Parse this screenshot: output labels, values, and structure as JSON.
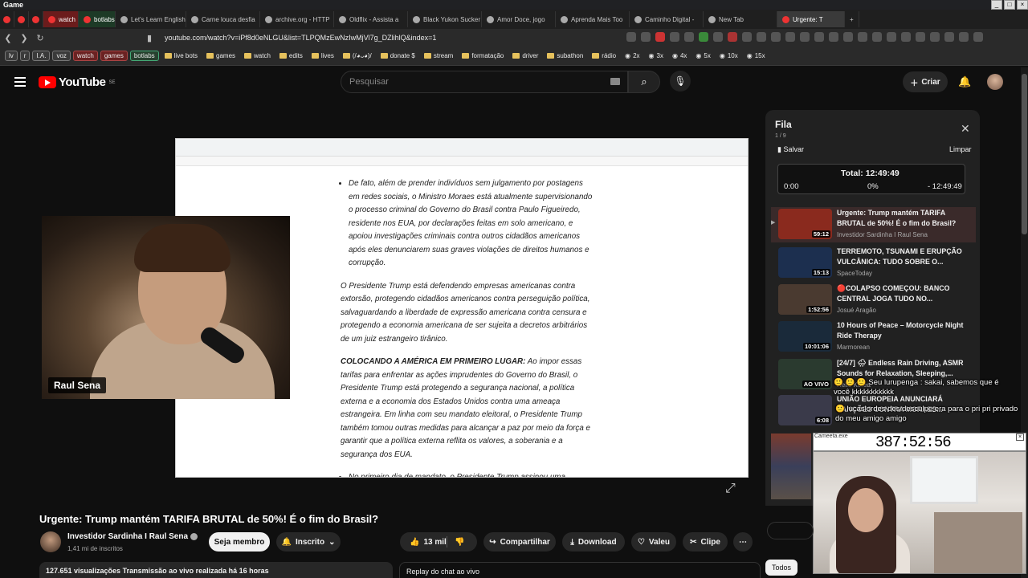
{
  "window": {
    "title": "Game"
  },
  "tabs": [
    {
      "label": "",
      "style": "pinned"
    },
    {
      "label": "",
      "style": "pinned"
    },
    {
      "label": "",
      "style": "pinned"
    },
    {
      "label": "watch",
      "style": "red"
    },
    {
      "label": "botlabs",
      "style": "green"
    },
    {
      "label": "Let's Learn English",
      "style": "plain"
    },
    {
      "label": "Carne louca desfia",
      "style": "plain"
    },
    {
      "label": "archive.org - HTTP",
      "style": "plain"
    },
    {
      "label": "Oldflix - Assista a",
      "style": "plain"
    },
    {
      "label": "Black Yukon Sucker",
      "style": "plain"
    },
    {
      "label": "Amor Doce, jogo",
      "style": "plain"
    },
    {
      "label": "Aprenda Mais Too",
      "style": "plain"
    },
    {
      "label": "Caminho Digital -",
      "style": "plain"
    },
    {
      "label": "New Tab",
      "style": "plain"
    },
    {
      "label": "Urgente: T",
      "style": "active"
    }
  ],
  "address": {
    "url": "youtube.com/watch?v=iPf8d0eNLGU&list=TLPQMzEwNzIwMjVl7g_DZlihlQ&index=1"
  },
  "bookmarks": [
    {
      "label": "lv",
      "kind": "tag"
    },
    {
      "label": "r",
      "kind": "tag"
    },
    {
      "label": "I.A.",
      "kind": "tag"
    },
    {
      "label": "voz",
      "kind": "tag"
    },
    {
      "label": "watch",
      "kind": "tag"
    },
    {
      "label": "games",
      "kind": "tag"
    },
    {
      "label": "botlabs",
      "kind": "tag"
    },
    {
      "label": "live bots",
      "kind": "folder"
    },
    {
      "label": "games",
      "kind": "folder"
    },
    {
      "label": "watch",
      "kind": "folder"
    },
    {
      "label": "edits",
      "kind": "folder"
    },
    {
      "label": "lives",
      "kind": "folder"
    },
    {
      "label": "(/◕ᴗ◕)/",
      "kind": "folder"
    },
    {
      "label": "donate $",
      "kind": "folder"
    },
    {
      "label": "stream",
      "kind": "folder"
    },
    {
      "label": "formatação",
      "kind": "folder"
    },
    {
      "label": "driver",
      "kind": "folder"
    },
    {
      "label": "subathon",
      "kind": "folder"
    },
    {
      "label": "rádio",
      "kind": "folder"
    },
    {
      "label": "2x",
      "kind": "link"
    },
    {
      "label": "3x",
      "kind": "link"
    },
    {
      "label": "4x",
      "kind": "link"
    },
    {
      "label": "5x",
      "kind": "link"
    },
    {
      "label": "10x",
      "kind": "link"
    },
    {
      "label": "15x",
      "kind": "link"
    }
  ],
  "youtube": {
    "logo": "YouTube",
    "region": "SE",
    "search_placeholder": "Pesquisar",
    "create_label": "Criar"
  },
  "video": {
    "title": "Urgente: Trump mantém TARIFA BRUTAL de 50%! É o fim do Brasil?",
    "streamer_name": "Raul Sena",
    "doc_paragraphs": {
      "p1": "De fato, além de prender indivíduos sem julgamento por postagens em redes sociais, o Ministro Moraes está atualmente supervisionando o processo criminal do Governo do Brasil contra Paulo Figueiredo, residente nos EUA, por declarações feitas em solo americano, e apoiou investigações criminais contra outros cidadãos americanos após eles denunciarem suas graves violações de direitos humanos e corrupção.",
      "p2": "O Presidente Trump está defendendo empresas americanas contra extorsão, protegendo cidadãos americanos contra perseguição política, salvaguardando a liberdade de expressão americana contra censura e protegendo a economia americana de ser sujeita a decretos arbitrários de um juiz estrangeiro tirânico.",
      "p3_bold": "COLOCANDO A AMÉRICA EM PRIMEIRO LUGAR:",
      "p3": " Ao impor essas tarifas para enfrentar as ações imprudentes do Governo do Brasil, o Presidente Trump está protegendo a segurança nacional, a política externa e a economia dos Estados Unidos contra uma ameaça estrangeira. Em linha com seu mandato eleitoral, o Presidente Trump também tomou outras medidas para alcançar a paz por meio da força e garantir que a política externa reflita os valores, a soberania e a segurança dos EUA.",
      "p4": "No primeiro dia de mandato, o Presidente Trump assinou uma \"Diretiva de Política América Primeiro\" ao Secretário de Estado, declarando que a"
    }
  },
  "channel": {
    "name": "Investidor Sardinha I Raul Sena",
    "subscribers": "1,41 mi de inscritos",
    "member_button": "Seja membro",
    "subscribed_button": "Inscrito"
  },
  "actions": {
    "likes": "13 mil",
    "share": "Compartilhar",
    "download": "Download",
    "thanks": "Valeu",
    "clip": "Clipe"
  },
  "stats": {
    "views_line": "127.651 visualizações  Transmissão ao vivo realizada há 16 horas",
    "chat_replay": "Replay do chat ao vivo"
  },
  "queue": {
    "title": "Fila",
    "count": "1 / 9",
    "save": "Salvar",
    "clear": "Limpar",
    "timer_total": "Total: 12:49:49",
    "timer_start": "0:00",
    "timer_pct": "0%",
    "timer_end": "- 12:49:49",
    "items": [
      {
        "title": "Urgente: Trump mantém TARIFA BRUTAL de 50%! É o fim do Brasil?",
        "channel": "Investidor Sardinha I Raul Sena",
        "duration": "59:12",
        "thumb": "#8a2a1e"
      },
      {
        "title": "TERREMOTO, TSUNAMI E ERUPÇÃO VULCÂNICA: TUDO SOBRE O...",
        "channel": "SpaceToday",
        "duration": "15:13",
        "thumb": "#1c2f4f"
      },
      {
        "title": "🔴COLAPSO COMEÇOU: BANCO CENTRAL JOGA TUDO NO...",
        "channel": "Josué Aragão",
        "duration": "1:52:56",
        "thumb": "#4a3a30"
      },
      {
        "title": "10 Hours of Peace – Motorcycle Night Ride Therapy",
        "channel": "Marmorean",
        "duration": "10:01:06",
        "thumb": "#1a2a3a"
      },
      {
        "title": "[24/7] 🌧 Endless Rain Driving, ASMR Sounds for Relaxation, Sleeping,...",
        "channel": "Hello Korea",
        "duration": "AO VIVO",
        "thumb": "#2a3a2f"
      },
      {
        "title": "UNIÃO EUROPEIA ANUNCIARÁ SANÇÕES CONTRA MORAES...",
        "channel": "",
        "duration": "6:08",
        "thumb": "#3a3a4a"
      }
    ]
  },
  "overlay": {
    "chat_line1": "🙂 🙂 🙂 Seu lurupenga : sakai, sabemos que é você kkkkkkkkkkk",
    "chat_line2": "🙂 lucaslordes des desculpe era para o pri pri privado do meu amigo amigo",
    "stopwatch_label": "Cameeta.exe",
    "stopwatch_time": "387:52:56"
  },
  "filters": {
    "all": "Todos"
  }
}
